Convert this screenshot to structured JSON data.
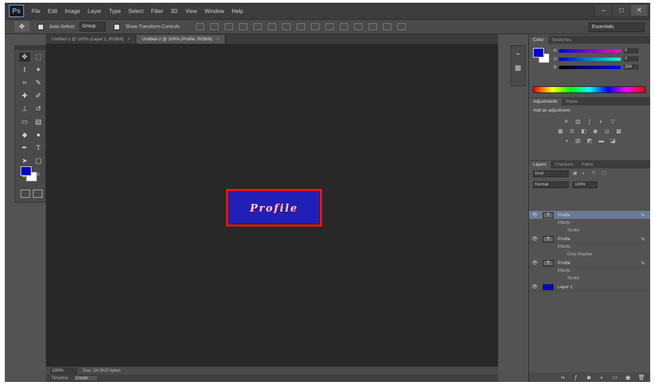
{
  "menu": {
    "logo": "Ps",
    "items": [
      "File",
      "Edit",
      "Image",
      "Layer",
      "Type",
      "Select",
      "Filter",
      "3D",
      "View",
      "Window",
      "Help"
    ]
  },
  "window_controls": {
    "minimize": "–",
    "maximize": "□",
    "close": "✕"
  },
  "options_bar": {
    "auto_select_label": "Auto-Select:",
    "auto_select_value": "Group",
    "transform_label": "Show Transform Controls",
    "workspace": "Essentials"
  },
  "tabs": [
    {
      "label": "Untitled-1 @ 100% (Layer 1, RGB/8)",
      "active": false
    },
    {
      "label": "Untitled-2 @ 100% (Profile, RGB/8)",
      "active": true
    }
  ],
  "canvas": {
    "text": "Profile",
    "doc_color": "#2020b8",
    "highlight_color": "#ff1010"
  },
  "status": {
    "zoom": "100%",
    "doc_info": "Doc: 24.5K/0 bytes",
    "timeline_label": "Timeline",
    "timeline_button": "Create"
  },
  "colors": {
    "foreground": "#0000cc",
    "background": "#ffffff"
  },
  "color_panel": {
    "tabs": [
      "Color",
      "Swatches"
    ],
    "sliders": [
      {
        "label": "R",
        "value": "0"
      },
      {
        "label": "G",
        "value": "0"
      },
      {
        "label": "B",
        "value": "204"
      }
    ]
  },
  "adjustments_panel": {
    "tabs": [
      "Adjustments",
      "Styles"
    ],
    "title": "Add an adjustment"
  },
  "layers_panel": {
    "tabs": [
      "Layers",
      "Channels",
      "Paths"
    ],
    "kind": "Kind",
    "blend_mode": "Normal",
    "opacity": "100%",
    "layers": [
      {
        "name": "Profile",
        "thumb": "T",
        "selected": true,
        "fx": "fx",
        "subs": [
          "Effects",
          "Stroke"
        ]
      },
      {
        "name": "Profile",
        "thumb": "T",
        "selected": false,
        "fx": "fx",
        "subs": [
          "Effects",
          "Drop Shadow"
        ]
      },
      {
        "name": "Profile",
        "thumb": "T",
        "selected": false,
        "fx": "fx",
        "subs": [
          "Effects",
          "Stroke"
        ]
      },
      {
        "name": "Layer 1",
        "thumb": "",
        "selected": false,
        "fx": "",
        "subs": []
      }
    ]
  }
}
